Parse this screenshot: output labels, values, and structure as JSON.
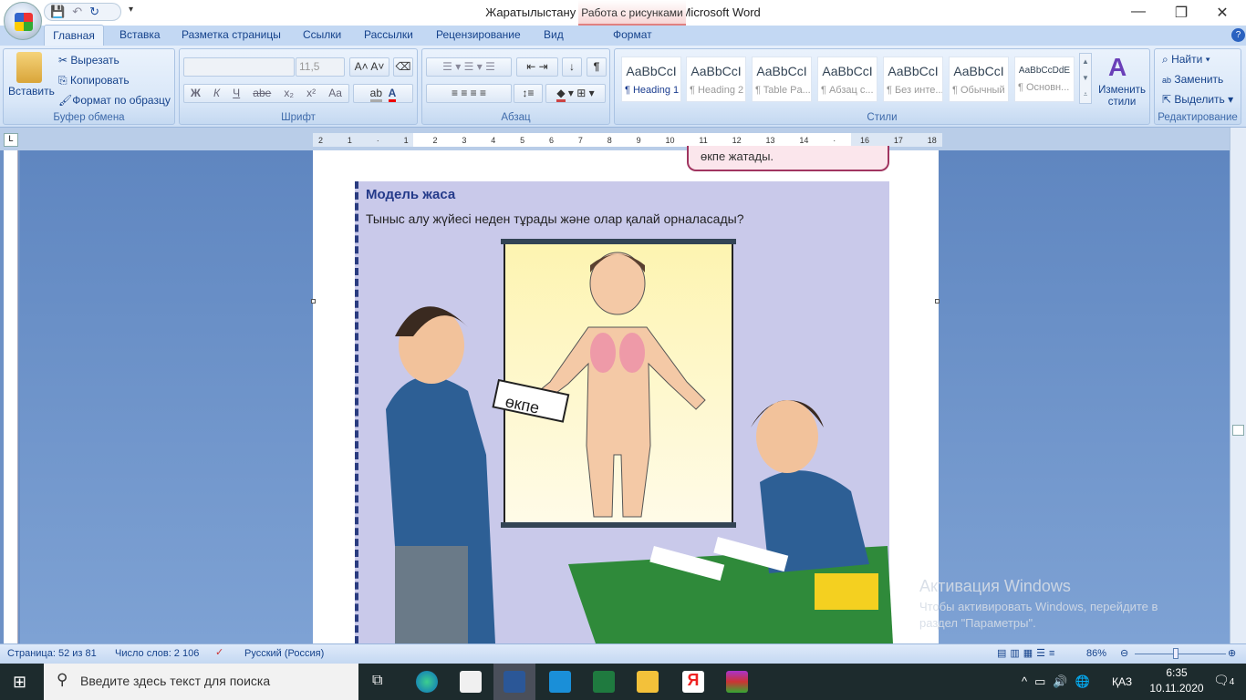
{
  "window": {
    "title": "Жаратылыстану 3-сынып,1-бөлім - Microsoft Word",
    "context_tab": "Работа с рисунками"
  },
  "tabs": [
    "Главная",
    "Вставка",
    "Разметка страницы",
    "Ссылки",
    "Рассылки",
    "Рецензирование",
    "Вид",
    "Формат"
  ],
  "clipboard": {
    "paste": "Вставить",
    "cut": "Вырезать",
    "copy": "Копировать",
    "format_painter": "Формат по образцу",
    "label": "Буфер обмена"
  },
  "font": {
    "name": "",
    "size": "11,5",
    "label": "Шрифт",
    "bold": "Ж",
    "italic": "К",
    "underline": "Ч",
    "strike": "abe",
    "sub": "x₂",
    "sup": "x²",
    "case": "Aa"
  },
  "paragraph": {
    "label": "Абзац"
  },
  "styles": {
    "label": "Стили",
    "items": [
      {
        "preview": "AaBbCcI",
        "name": "¶ Heading 1"
      },
      {
        "preview": "AaBbCcI",
        "name": "¶ Heading 2"
      },
      {
        "preview": "AaBbCcI",
        "name": "¶ Table Pa..."
      },
      {
        "preview": "AaBbCcI",
        "name": "¶ Абзац с..."
      },
      {
        "preview": "AaBbCcI",
        "name": "¶ Без инте..."
      },
      {
        "preview": "AaBbCcI",
        "name": "¶ Обычный"
      },
      {
        "preview": "AaBbCcDdE",
        "name": "¶ Основн..."
      }
    ],
    "change": "Изменить стили"
  },
  "editing": {
    "find": "Найти",
    "replace": "Заменить",
    "select": "Выделить",
    "label": "Редактирование"
  },
  "ruler": {
    "ticks": [
      "2",
      "1",
      "",
      "1",
      "2",
      "3",
      "4",
      "5",
      "6",
      "7",
      "8",
      "9",
      "10",
      "11",
      "12",
      "13",
      "14",
      "",
      "16",
      "17",
      "18"
    ]
  },
  "document": {
    "callout": "өкпе жатады.",
    "heading": "Модель жаса",
    "question": "Тыныс алу жүйесі неден тұрады және олар қалай орналасады?",
    "card": "өкпе"
  },
  "status": {
    "page": "Страница: 52 из 81",
    "words": "Число слов: 2 106",
    "language": "Русский (Россия)",
    "zoom": "86%",
    "zoom_value": 86
  },
  "watermark": {
    "title": "Активация Windows",
    "line1": "Чтобы активировать Windows, перейдите в",
    "line2": "раздел \"Параметры\"."
  },
  "taskbar": {
    "search_placeholder": "Введите здесь текст для поиска",
    "lang": "ҚАЗ",
    "time": "6:35",
    "date": "10.11.2020",
    "notifications": "4"
  }
}
